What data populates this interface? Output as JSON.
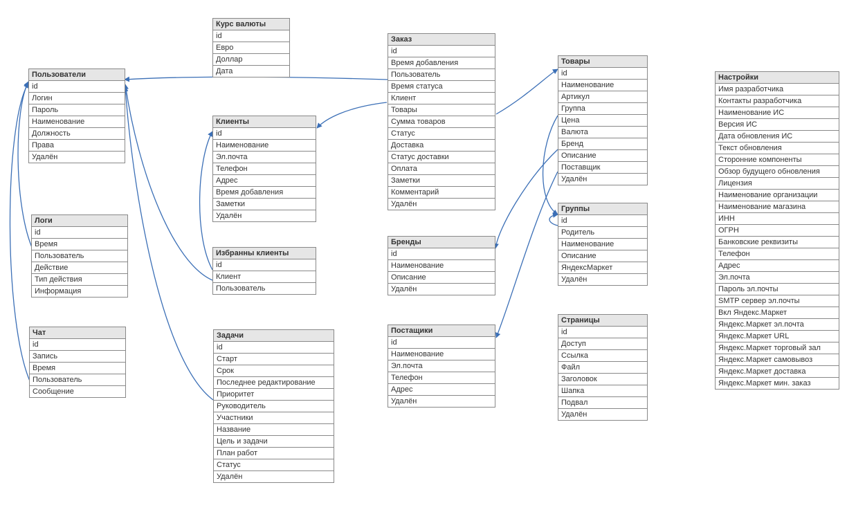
{
  "tables": {
    "users": {
      "title": "Пользователи",
      "fields": [
        "id",
        "Логин",
        "Пароль",
        "Наименование",
        "Должность",
        "Права",
        "Удалён"
      ]
    },
    "currency": {
      "title": "Курс валюты",
      "fields": [
        "id",
        "Евро",
        "Доллар",
        "Дата"
      ]
    },
    "clients": {
      "title": "Клиенты",
      "fields": [
        "id",
        "Наименование",
        "Эл.почта",
        "Телефон",
        "Адрес",
        "Время добавления",
        "Заметки",
        "Удалён"
      ]
    },
    "fav": {
      "title": "Избранны клиенты",
      "fields": [
        "id",
        "Клиент",
        "Пользователь"
      ]
    },
    "tasks": {
      "title": "Задачи",
      "fields": [
        "id",
        "Старт",
        "Срок",
        "Последнее редактирование",
        "Приоритет",
        "Руководитель",
        "Участники",
        "Название",
        "Цель и задачи",
        "План работ",
        "Статус",
        "Удалён"
      ]
    },
    "logs": {
      "title": "Логи",
      "fields": [
        "id",
        "Время",
        "Пользователь",
        "Действие",
        "Тип действия",
        "Информация"
      ]
    },
    "chat": {
      "title": "Чат",
      "fields": [
        "id",
        "Запись",
        "Время",
        "Пользователь",
        "Сообщение"
      ]
    },
    "order": {
      "title": "Заказ",
      "fields": [
        "id",
        "Время добавления",
        "Пользователь",
        "Время статуса",
        "Клиент",
        "Товары",
        "Сумма товаров",
        "Статус",
        "Доставка",
        "Статус доставки",
        "Оплата",
        "Заметки",
        "Комментарий",
        "Удалён"
      ]
    },
    "brands": {
      "title": "Бренды",
      "fields": [
        "id",
        "Наименование",
        "Описание",
        "Удалён"
      ]
    },
    "suppliers": {
      "title": "Постащики",
      "fields": [
        "id",
        "Наименование",
        "Эл.почта",
        "Телефон",
        "Адрес",
        "Удалён"
      ]
    },
    "goods": {
      "title": "Товары",
      "fields": [
        "id",
        "Наименование",
        "Артикул",
        "Группа",
        "Цена",
        "Валюта",
        "Бренд",
        "Описание",
        "Поставщик",
        "Удалён"
      ]
    },
    "groups": {
      "title": "Группы",
      "fields": [
        "id",
        "Родитель",
        "Наименование",
        "Описание",
        "ЯндексМаркет",
        "Удалён"
      ]
    },
    "pages": {
      "title": "Страницы",
      "fields": [
        "id",
        "Доступ",
        "Ссылка",
        "Файл",
        "Заголовок",
        "Шапка",
        "Подвал",
        "Удалён"
      ]
    },
    "settings": {
      "title": "Настройки",
      "fields": [
        "Имя разработчика",
        "Контакты разработчика",
        "Наименование ИС",
        "Версия ИС",
        "Дата обновления ИС",
        "Текст обновления",
        "Сторонние компоненты",
        "Обзор будущего обновления",
        "Лицензия",
        "Наименование организации",
        "Наименование магазина",
        "ИНН",
        "ОГРН",
        "Банковские реквизиты",
        "Телефон",
        "Адрес",
        "Эл.почта",
        "Пароль эл.почты",
        "SMTP сервер эл.почты",
        "Вкл Яндекс.Маркет",
        "Яндекс.Маркет эл.почта",
        "Яндекс.Маркет URL",
        "Яндекс.Маркет торговый зал",
        "Яндекс.Маркет самовывоз",
        "Яндекс.Маркет доставка",
        "Яндекс.Маркет мин. заказ"
      ]
    }
  },
  "relations": [
    {
      "from": "order.Пользователь",
      "to": "users.id"
    },
    {
      "from": "logs.Пользователь",
      "to": "users.id"
    },
    {
      "from": "chat.Пользователь",
      "to": "users.id"
    },
    {
      "from": "fav.Пользователь",
      "to": "users.id"
    },
    {
      "from": "tasks.Руководитель",
      "to": "users.id"
    },
    {
      "from": "order.Клиент",
      "to": "clients.id"
    },
    {
      "from": "fav.Клиент",
      "to": "clients.id"
    },
    {
      "from": "order.Товары",
      "to": "goods.id"
    },
    {
      "from": "goods.Бренд",
      "to": "brands.id"
    },
    {
      "from": "goods.Группа",
      "to": "groups.id"
    },
    {
      "from": "goods.Поставщик",
      "to": "suppliers.id"
    },
    {
      "from": "groups.Родитель",
      "to": "groups.id"
    }
  ]
}
